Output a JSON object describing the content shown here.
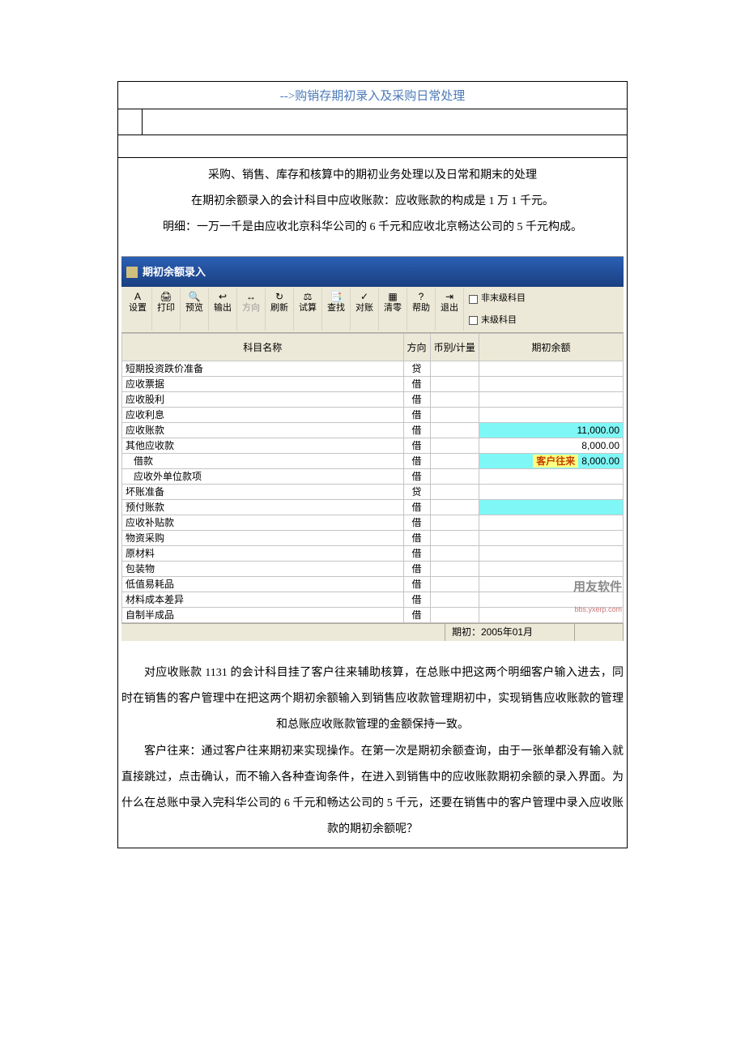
{
  "doc": {
    "title": "-->购销存期初录入及采购日常处理",
    "intro": {
      "p1": "采购、销售、库存和核算中的期初业务处理以及日常和期末的处理",
      "p2": "在期初余额录入的会计科目中应收账款：应收账款的构成是 1 万 1 千元。",
      "p3": "明细：一万一千是由应收北京科华公司的 6 千元和应收北京畅达公司的 5 千元构成。"
    },
    "explain": {
      "p1": "对应收账款 1131 的会计科目挂了客户往来辅助核算，在总账中把这两个明细客户输入进去，同时在销售的客户管理中在把这两个期初余额输入到销售应收款管理期初中，实现销售应收账款的管理和总账应收账款管理的金额保持一致。",
      "p2": "客户往来：通过客户往来期初来实现操作。在第一次是期初余额查询，由于一张单都没有输入就直接跳过，点击确认，而不输入各种查询条件，在进入到销售中的应收账款期初余额的录入界面。为什么在总账中录入完科华公司的 6 千元和畅达公司的 5 千元，还要在销售中的客户管理中录入应收账款的期初余额呢？"
    }
  },
  "screenshot": {
    "window_title": "期初余额录入",
    "toolbar": {
      "btns": [
        {
          "label": "设置",
          "icon": "A"
        },
        {
          "label": "打印",
          "icon": "🖨"
        },
        {
          "label": "预览",
          "icon": "🔍"
        },
        {
          "label": "输出",
          "icon": "↩"
        },
        {
          "label": "方向",
          "icon": "↔",
          "dim": true
        },
        {
          "label": "刷新",
          "icon": "↻"
        },
        {
          "label": "试算",
          "icon": "⚖"
        },
        {
          "label": "查找",
          "icon": "📑"
        },
        {
          "label": "对账",
          "icon": "✓"
        },
        {
          "label": "清零",
          "icon": "▦"
        },
        {
          "label": "帮助",
          "icon": "?"
        },
        {
          "label": "退出",
          "icon": "⇥"
        }
      ],
      "checks": [
        "非末级科目",
        "末级科目"
      ]
    },
    "grid": {
      "headers": {
        "name": "科目名称",
        "dir": "方向",
        "cur": "币别/计量",
        "bal": "期初余额"
      },
      "rows": [
        {
          "name": "短期投资跌价准备",
          "dir": "贷",
          "bal": "",
          "indent": 0
        },
        {
          "name": "应收票据",
          "dir": "借",
          "bal": "",
          "indent": 0
        },
        {
          "name": "应收股利",
          "dir": "借",
          "bal": "",
          "indent": 0
        },
        {
          "name": "应收利息",
          "dir": "借",
          "bal": "",
          "indent": 0
        },
        {
          "name": "应收账款",
          "dir": "借",
          "bal": "11,000.00",
          "cyan": true,
          "indent": 0
        },
        {
          "name": "其他应收款",
          "dir": "借",
          "bal": "8,000.00",
          "indent": 0
        },
        {
          "name": "借款",
          "dir": "借",
          "bal": "8,000.00",
          "cyan": true,
          "badge": "客户往来",
          "indent": 1
        },
        {
          "name": "应收外单位款项",
          "dir": "借",
          "bal": "",
          "indent": 1
        },
        {
          "name": "坏账准备",
          "dir": "贷",
          "bal": "",
          "indent": 0
        },
        {
          "name": "预付账款",
          "dir": "借",
          "bal": "",
          "cyan": true,
          "indent": 0
        },
        {
          "name": "应收补贴款",
          "dir": "借",
          "bal": "",
          "indent": 0
        },
        {
          "name": "物资采购",
          "dir": "借",
          "bal": "",
          "indent": 0
        },
        {
          "name": "原材料",
          "dir": "借",
          "bal": "",
          "indent": 0
        },
        {
          "name": "包装物",
          "dir": "借",
          "bal": "",
          "indent": 0
        },
        {
          "name": "低值易耗品",
          "dir": "借",
          "bal": "",
          "indent": 0
        },
        {
          "name": "材料成本差异",
          "dir": "借",
          "bal": "",
          "indent": 0
        },
        {
          "name": "自制半成品",
          "dir": "借",
          "bal": "",
          "indent": 0
        }
      ]
    },
    "statusbar": {
      "period": "期初：2005年01月"
    },
    "watermark": {
      "line1": "用友软件",
      "line2": "bbs.yxerp.com"
    }
  }
}
